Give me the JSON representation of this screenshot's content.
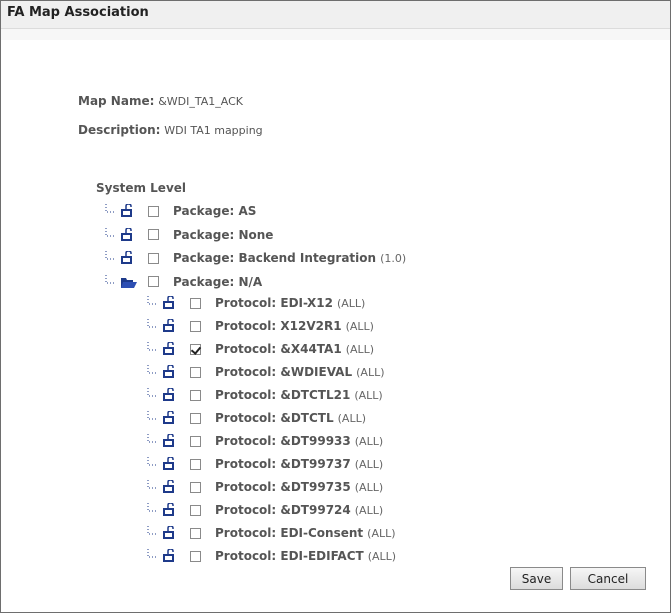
{
  "window": {
    "title": "FA Map Association"
  },
  "map": {
    "name_label": "Map Name:",
    "name_value": "&WDI_TA1_ACK",
    "desc_label": "Description:",
    "desc_value": "WDI TA1 mapping"
  },
  "tree": {
    "root_label": "System Level",
    "packages": [
      {
        "label": "Package: AS",
        "version": ""
      },
      {
        "label": "Package: None",
        "version": ""
      },
      {
        "label": "Package: Backend Integration",
        "version": "(1.0)"
      },
      {
        "label": "Package: N/A",
        "version": ""
      }
    ],
    "protocols": [
      {
        "label": "Protocol: EDI-X12",
        "version": "(ALL)",
        "checked": false
      },
      {
        "label": "Protocol: X12V2R1",
        "version": "(ALL)",
        "checked": false
      },
      {
        "label": "Protocol: &X44TA1",
        "version": "(ALL)",
        "checked": true
      },
      {
        "label": "Protocol: &WDIEVAL",
        "version": "(ALL)",
        "checked": false
      },
      {
        "label": "Protocol: &DTCTL21",
        "version": "(ALL)",
        "checked": false
      },
      {
        "label": "Protocol: &DTCTL",
        "version": "(ALL)",
        "checked": false
      },
      {
        "label": "Protocol: &DT99933",
        "version": "(ALL)",
        "checked": false
      },
      {
        "label": "Protocol: &DT99737",
        "version": "(ALL)",
        "checked": false
      },
      {
        "label": "Protocol: &DT99735",
        "version": "(ALL)",
        "checked": false
      },
      {
        "label": "Protocol: &DT99724",
        "version": "(ALL)",
        "checked": false
      },
      {
        "label": "Protocol: EDI-Consent",
        "version": "(ALL)",
        "checked": false
      },
      {
        "label": "Protocol: EDI-EDIFACT",
        "version": "(ALL)",
        "checked": false
      }
    ]
  },
  "buttons": {
    "save": "Save",
    "cancel": "Cancel"
  },
  "icons": {
    "folder_closed": "folder-closed-icon",
    "folder_open": "folder-open-icon"
  },
  "colors": {
    "folder": "#1e3a8a",
    "connector": "#1e3a8a"
  }
}
